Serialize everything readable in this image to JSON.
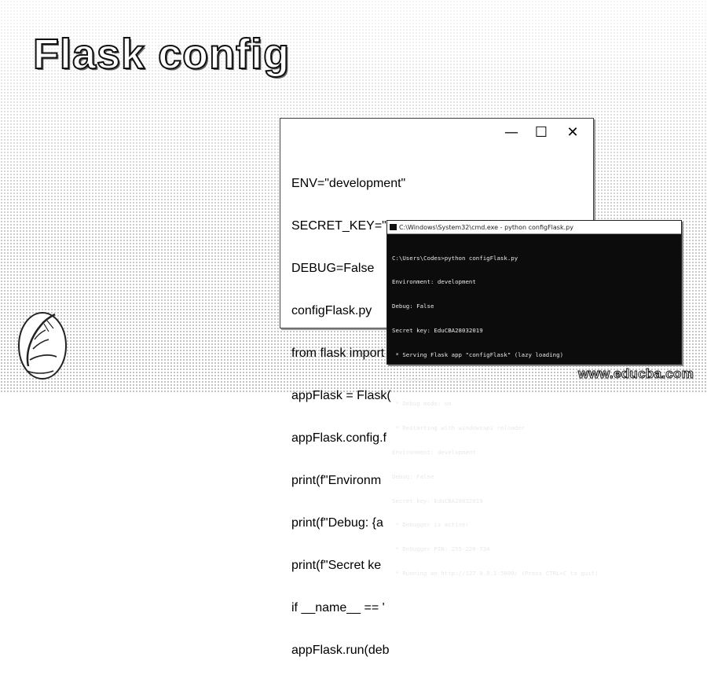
{
  "banner": {
    "title": "Flask config"
  },
  "editor": {
    "controls": {
      "minimize": "—",
      "maximize": "☐",
      "close": "✕"
    },
    "lines": [
      "ENV=\"development\"",
      "SECRET_KEY=\"EduCBA28032019\"",
      "DEBUG=False",
      "configFlask.py",
      "from flask import Flask",
      "appFlask = Flask(",
      "appFlask.config.f",
      "print(f\"Environm",
      "print(f\"Debug: {a",
      "print(f\"Secret ke",
      "if __name__ == '",
      "appFlask.run(deb"
    ]
  },
  "terminal": {
    "title": "C:\\Windows\\System32\\cmd.exe - python  configFlask.py",
    "lines": [
      "C:\\Users\\Codes>python configFlask.py",
      "Environment: development",
      "Debug: False",
      "Secret key: EduCBA28032019",
      " * Serving Flask app \"configFlask\" (lazy loading)",
      " * Environment: development",
      " * Debug mode: on",
      " * Restarting with windowsapi reloader",
      "Environment: development",
      "Debug: False",
      "Secret key: EduCBA28032019",
      " * Debugger is active!",
      " * Debugger PIN: 255-220-734",
      " * Running on http://127.0.0.1:5000/ (Press CTRL+C to quit)"
    ]
  },
  "footer": {
    "brand": "www.educba.com"
  },
  "icons": {
    "logo": "flask-logo-icon",
    "terminal": "cmd-icon"
  }
}
